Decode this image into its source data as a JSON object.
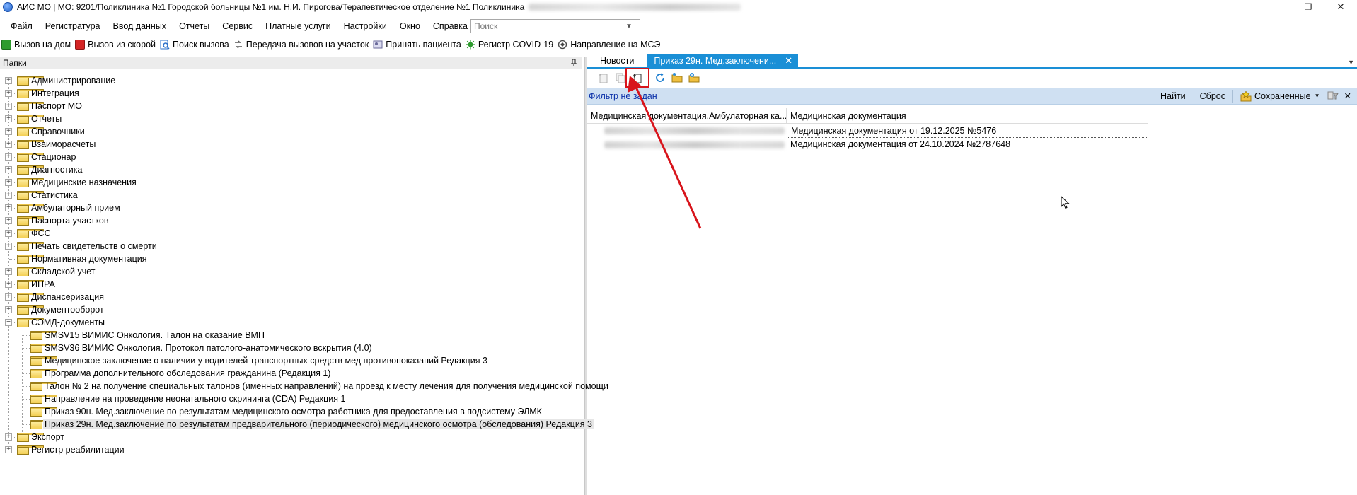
{
  "window": {
    "title": "АИС МО | МО: 9201/Поликлиника №1 Городской больницы №1 им. Н.И. Пирогова/Терапевтическое отделение №1 Поликлиника",
    "minimize": "—",
    "maximize": "❐",
    "close": "✕"
  },
  "menu": {
    "items": [
      "Файл",
      "Регистратура",
      "Ввод данных",
      "Отчеты",
      "Сервис",
      "Платные услуги",
      "Настройки",
      "Окно",
      "Справка"
    ],
    "search_placeholder": "Поиск"
  },
  "quickbar": {
    "items": [
      {
        "label": "Вызов на дом",
        "icon": "home-call-icon",
        "color": "#2e9b2e"
      },
      {
        "label": "Вызов из скорой",
        "icon": "ambulance-call-icon",
        "color": "#d42424"
      },
      {
        "label": "Поиск вызова",
        "icon": "search-call-icon",
        "color": "#2a6fc9"
      },
      {
        "label": "Передача вызовов на участок",
        "icon": "transfer-calls-icon",
        "color": "#555555"
      },
      {
        "label": "Принять пациента",
        "icon": "accept-patient-icon",
        "color": "#6a6a9a"
      },
      {
        "label": "Регистр COVID-19",
        "icon": "covid-icon",
        "color": "#2e9b2e"
      },
      {
        "label": "Направление на МСЭ",
        "icon": "mse-referral-icon",
        "color": "#444444"
      }
    ]
  },
  "left_pane": {
    "title": "Папки",
    "tree": [
      {
        "label": "Администрирование",
        "level": 0,
        "expander": "+"
      },
      {
        "label": "Интеграция",
        "level": 0,
        "expander": "+"
      },
      {
        "label": "Паспорт МО",
        "level": 0,
        "expander": "+"
      },
      {
        "label": "Отчеты",
        "level": 0,
        "expander": "+"
      },
      {
        "label": "Справочники",
        "level": 0,
        "expander": "+"
      },
      {
        "label": "Взаиморасчеты",
        "level": 0,
        "expander": "+"
      },
      {
        "label": "Стационар",
        "level": 0,
        "expander": "+"
      },
      {
        "label": "Диагностика",
        "level": 0,
        "expander": "+"
      },
      {
        "label": "Медицинские назначения",
        "level": 0,
        "expander": "+"
      },
      {
        "label": "Статистика",
        "level": 0,
        "expander": "+"
      },
      {
        "label": "Амбулаторный прием",
        "level": 0,
        "expander": "+"
      },
      {
        "label": "Паспорта участков",
        "level": 0,
        "expander": "+"
      },
      {
        "label": "ФСС",
        "level": 0,
        "expander": "+"
      },
      {
        "label": "Печать свидетельств о смерти",
        "level": 0,
        "expander": "+"
      },
      {
        "label": "Нормативная документация",
        "level": 0,
        "expander": ""
      },
      {
        "label": "Складской учет",
        "level": 0,
        "expander": "+"
      },
      {
        "label": "ИПРА",
        "level": 0,
        "expander": "+"
      },
      {
        "label": "Диспансеризация",
        "level": 0,
        "expander": "+"
      },
      {
        "label": "Документооборот",
        "level": 0,
        "expander": "+"
      },
      {
        "label": "СЭМД-документы",
        "level": 0,
        "expander": "−"
      },
      {
        "label": "SMSV15 ВИМИС Онкология. Талон на оказание ВМП",
        "level": 1,
        "expander": ""
      },
      {
        "label": "SMSV36 ВИМИС Онкология. Протокол патолого-анатомического вскрытия (4.0)",
        "level": 1,
        "expander": ""
      },
      {
        "label": "Медицинское заключение о наличии у водителей транспортных средств мед противопоказаний Редакция 3",
        "level": 1,
        "expander": ""
      },
      {
        "label": "Программа дополнительного обследования гражданина (Редакция 1)",
        "level": 1,
        "expander": ""
      },
      {
        "label": "Талон № 2 на получение специальных талонов (именных направлений) на проезд к месту лечения для получения медицинской помощи",
        "level": 1,
        "expander": ""
      },
      {
        "label": "Направление на проведение неонатального скрининга (CDA) Редакция 1",
        "level": 1,
        "expander": ""
      },
      {
        "label": "Приказ 90н. Мед.заключение по результатам медицинского осмотра работника для предоставления в подсистему ЭЛМК",
        "level": 1,
        "expander": ""
      },
      {
        "label": "Приказ 29н. Мед.заключение по результатам предварительного (периодического) медицинского осмотра (обследования) Редакция 3",
        "level": 1,
        "expander": "",
        "selected": true
      },
      {
        "label": "Экспорт",
        "level": 0,
        "expander": "+"
      },
      {
        "label": "Регистр реабилитации",
        "level": 0,
        "expander": "+"
      }
    ]
  },
  "right_pane": {
    "tabs": [
      {
        "label": "Новости",
        "active": false
      },
      {
        "label": "Приказ 29н. Мед.заключени...",
        "active": true
      }
    ],
    "tab_close": "✕",
    "filter_link": "Фильтр не задан",
    "find_label": "Найти",
    "reset_label": "Сброс",
    "saved_label": "Сохраненные",
    "close_filter": "✕",
    "grid": {
      "headers": [
        "Медицинская документация.Амбулаторная ка...",
        "Медицинская документация"
      ],
      "rows": [
        {
          "c2": "Медицинская документация от 19.12.2025 №5476"
        },
        {
          "c2": "Медицинская документация от 24.10.2024 №2787648"
        }
      ]
    }
  },
  "colors": {
    "tab_active": "#1a8fd6",
    "filter_bar": "#cfe0f2",
    "annotation": "#d8141b"
  }
}
